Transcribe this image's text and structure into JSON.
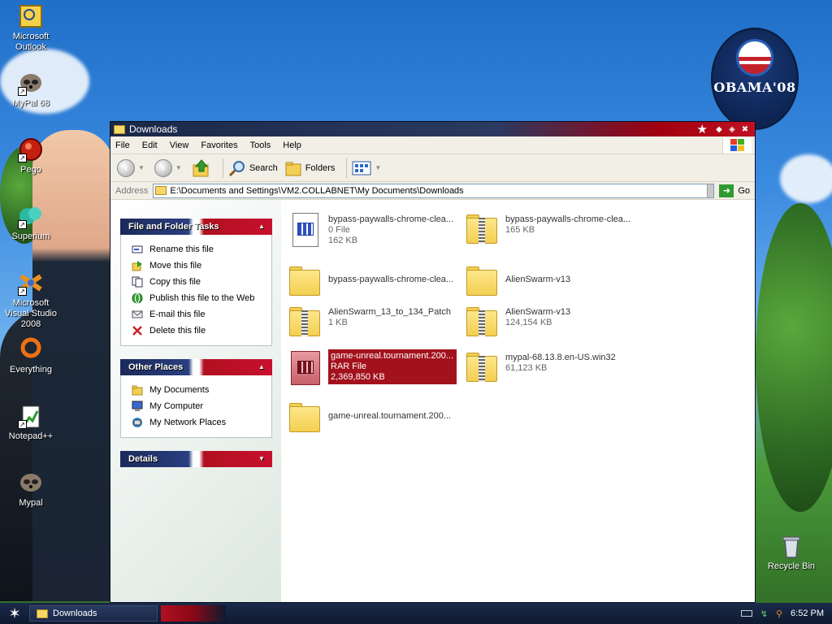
{
  "desktop": {
    "icons": [
      {
        "label": "Microsoft Outlook",
        "icon": "outlook-icon"
      },
      {
        "label": "MyPal 68",
        "icon": "raccoon-icon"
      },
      {
        "label": "Pego",
        "icon": "pego-icon"
      },
      {
        "label": "Superium",
        "icon": "superium-icon"
      },
      {
        "label": "Microsoft Visual Studio 2008",
        "icon": "visual-studio-icon"
      },
      {
        "label": "Everything",
        "icon": "everything-icon"
      },
      {
        "label": "Notepad++",
        "icon": "notepad-icon"
      },
      {
        "label": "Mypal",
        "icon": "raccoon-icon"
      },
      {
        "label": "Recycle Bin",
        "icon": "recycle-bin-icon"
      }
    ],
    "campaign_badge": "OBAMA'08"
  },
  "window": {
    "title": "Downloads",
    "menu": [
      "File",
      "Edit",
      "View",
      "Favorites",
      "Tools",
      "Help"
    ],
    "toolbar": {
      "search_label": "Search",
      "folders_label": "Folders"
    },
    "address": {
      "label": "Address",
      "value": "E:\\Documents and Settings\\VM2.COLLABNET\\My Documents\\Downloads",
      "go_label": "Go"
    },
    "panels": {
      "file_tasks": {
        "title": "File and Folder Tasks",
        "items": [
          {
            "label": "Rename this file",
            "icon": "rename-icon"
          },
          {
            "label": "Move this file",
            "icon": "move-icon"
          },
          {
            "label": "Copy this file",
            "icon": "copy-icon"
          },
          {
            "label": "Publish this file to the Web",
            "icon": "globe-icon"
          },
          {
            "label": "E-mail this file",
            "icon": "email-icon"
          },
          {
            "label": "Delete this file",
            "icon": "delete-icon"
          }
        ]
      },
      "other_places": {
        "title": "Other Places",
        "items": [
          {
            "label": "My Documents",
            "icon": "folder-icon"
          },
          {
            "label": "My Computer",
            "icon": "computer-icon"
          },
          {
            "label": "My Network Places",
            "icon": "network-icon"
          }
        ]
      },
      "details": {
        "title": "Details"
      }
    },
    "files": [
      {
        "name": "bypass-paywalls-chrome-clea...",
        "type": "0 File",
        "size": "162 KB",
        "kind": "doc"
      },
      {
        "name": "bypass-paywalls-chrome-clea...",
        "type": "",
        "size": "165 KB",
        "kind": "zip"
      },
      {
        "name": "bypass-paywalls-chrome-clea...",
        "type": "",
        "size": "",
        "kind": "folder"
      },
      {
        "name": "AlienSwarm-v13",
        "type": "",
        "size": "",
        "kind": "folder"
      },
      {
        "name": "AlienSwarm_13_to_134_Patch",
        "type": "",
        "size": "1 KB",
        "kind": "zip"
      },
      {
        "name": "AlienSwarm-v13",
        "type": "",
        "size": "124,154 KB",
        "kind": "zip"
      },
      {
        "name": "game-unreal.tournament.200...",
        "type": "RAR File",
        "size": "2,369,850 KB",
        "kind": "rar"
      },
      {
        "name": "mypal-68.13.8.en-US.win32",
        "type": "",
        "size": "61,123 KB",
        "kind": "zip"
      },
      {
        "name": "game-unreal.tournament.200...",
        "type": "",
        "size": "",
        "kind": "folder"
      }
    ]
  },
  "taskbar": {
    "task_label": "Downloads",
    "clock": "6:52 PM"
  }
}
